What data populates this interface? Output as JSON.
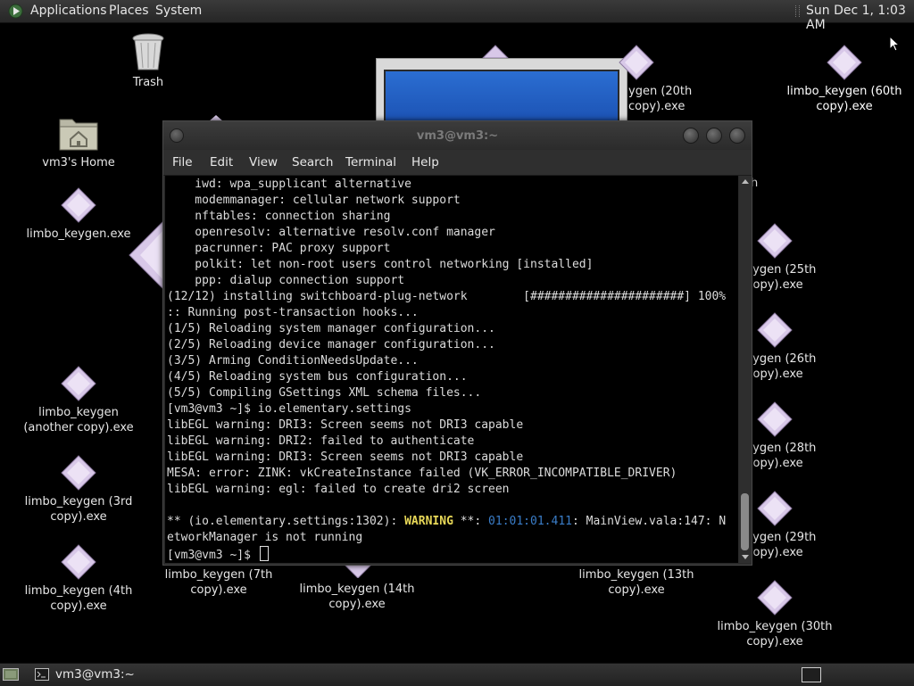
{
  "top_panel": {
    "menus": [
      "Applications",
      "Places",
      "System"
    ],
    "clock": "Sun Dec 1, 1:03 AM"
  },
  "desktop_icons": [
    {
      "label": "Trash",
      "icon": "trash-icon"
    },
    {
      "label": "vm3's Home",
      "icon": "home-folder-icon"
    },
    {
      "label": "limbo_keygen.exe",
      "icon": "executable-diamond-icon"
    },
    {
      "label": "limbo_keygen (another copy).exe",
      "icon": "executable-diamond-icon"
    },
    {
      "label": "limbo_keygen (3rd copy).exe",
      "icon": "executable-diamond-icon"
    },
    {
      "label": "limbo_keygen (4th copy).exe",
      "icon": "executable-diamond-icon"
    },
    {
      "label": "limbo_keygen (7th copy).exe",
      "icon": "executable-diamond-icon"
    },
    {
      "label": "limbo_keygen (14th copy).exe",
      "icon": "executable-diamond-icon"
    },
    {
      "label": "limbo_keygen (13th copy).exe",
      "icon": "executable-diamond-icon"
    },
    {
      "label": "limbo_keygen (30th copy).exe",
      "icon": "executable-diamond-icon"
    },
    {
      "label": "limbo_keygen (60th copy).exe",
      "icon": "executable-diamond-icon"
    },
    {
      "label": "ygen (20th\ncopy).exe",
      "icon": "executable-diamond-icon"
    },
    {
      "label": "_keygen (25th\ncopy).exe",
      "icon": "executable-diamond-icon"
    },
    {
      "label": "_keygen (26th\ncopy).exe",
      "icon": "executable-diamond-icon"
    },
    {
      "label": "_keygen (28th\ncopy).exe",
      "icon": "executable-diamond-icon"
    },
    {
      "label": "_keygen (29th\ncopy).exe",
      "icon": "executable-diamond-icon"
    },
    {
      "label": "h",
      "icon": ""
    }
  ],
  "terminal": {
    "title": "vm3@vm3:~",
    "menus": [
      "File",
      "Edit",
      "View",
      "Search",
      "Terminal",
      "Help"
    ],
    "lines": [
      "    iwd: wpa_supplicant alternative",
      "    modemmanager: cellular network support",
      "    nftables: connection sharing",
      "    openresolv: alternative resolv.conf manager",
      "    pacrunner: PAC proxy support",
      "    polkit: let non-root users control networking [installed]",
      "    ppp: dialup connection support",
      "(12/12) installing switchboard-plug-network        [######################] 100%",
      ":: Running post-transaction hooks...",
      "(1/5) Reloading system manager configuration...",
      "(2/5) Reloading device manager configuration...",
      "(3/5) Arming ConditionNeedsUpdate...",
      "(4/5) Reloading system bus configuration...",
      "(5/5) Compiling GSettings XML schema files...",
      "[vm3@vm3 ~]$ io.elementary.settings",
      "libEGL warning: DRI3: Screen seems not DRI3 capable",
      "libEGL warning: DRI2: failed to authenticate",
      "libEGL warning: DRI3: Screen seems not DRI3 capable",
      "MESA: error: ZINK: vkCreateInstance failed (VK_ERROR_INCOMPATIBLE_DRIVER)",
      "libEGL warning: egl: failed to create dri2 screen",
      ""
    ],
    "warning_line": {
      "prefix": "** (io.elementary.settings:1302): ",
      "level": "WARNING",
      "mid": " **: ",
      "timestamp": "01:01:01.411",
      "suffix": ": MainView.vala:147: N"
    },
    "wrap_line": "etworkManager is not running",
    "prompt": "[vm3@vm3 ~]$ "
  },
  "bottom_panel": {
    "task_label": "vm3@vm3:~"
  },
  "colors": {
    "desktop_bg": "#000000",
    "warning": "#e8d858",
    "timestamp": "#3a7dc8"
  }
}
